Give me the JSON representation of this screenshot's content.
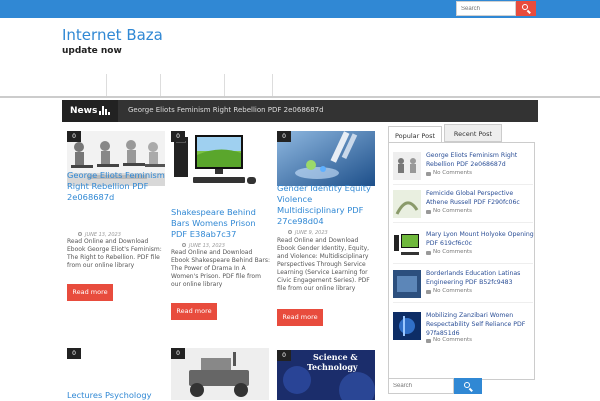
{
  "header": {
    "search_placeholder": "Search",
    "site_title": "Internet Baza",
    "tagline": "update now"
  },
  "newsbar": {
    "label": "News",
    "ticker": "George Eliots Feminism Right Rebellion PDF 2e068687d"
  },
  "posts": [
    {
      "badge": "0",
      "title": "George Eliots Feminism Right Rebellion PDF 2e068687d",
      "date": "JUNE 13, 2023",
      "excerpt": "Read Online and Download Ebook George Eliot's Feminism: The Right to Rebellion. PDF file from our online library",
      "readmore": "Read more"
    },
    {
      "badge": "0",
      "title": "Shakespeare Behind Bars Womens Prison PDF E38ab7c37",
      "date": "JUNE 13, 2023",
      "excerpt": "Read Online and Download Ebook Shakespeare Behind Bars: The Power of Drama In A Women's Prison. PDF file from our online library",
      "readmore": "Read more"
    },
    {
      "badge": "0",
      "title": "Gender Identity Equity Violence Multidisciplinary PDF 27ce98d04",
      "date": "JUNE 9, 2023",
      "excerpt": "Read Online and Download Ebook Gender Identity, Equity, and Violence: Multidisciplinary Perspectives Through Service Learning (Service Learning for Civic Engagement Series). PDF file from our online library",
      "readmore": "Read more"
    },
    {
      "badge": "0",
      "title": "Lectures Psychology"
    },
    {
      "badge": "0"
    },
    {
      "badge": "0",
      "thumb_text_1": "Science &",
      "thumb_text_2": "Technology"
    }
  ],
  "sidebar": {
    "tab_popular": "Popular Post",
    "tab_recent": "Recent Post",
    "items": [
      {
        "title": "George Eliots Feminism Right Rebellion PDF 2e068687d",
        "comments": "No Comments"
      },
      {
        "title": "Femicide Global Perspective Athene Russell PDF F290fc06c",
        "comments": "No Comments"
      },
      {
        "title": "Mary Lyon Mount Holyoke Opening PDF 619cf6c0c",
        "comments": "No Comments"
      },
      {
        "title": "Borderlands Education Latinas Engineering PDF B52fc9483",
        "comments": "No Comments"
      },
      {
        "title": "Mobilizing Zanzibari Women Respectability Self Reliance PDF 97fa851d6",
        "comments": "No Comments"
      }
    ],
    "search_placeholder": "Search"
  },
  "colors": {
    "accent": "#3088d4",
    "button": "#e84c3d",
    "dark": "#333333"
  }
}
